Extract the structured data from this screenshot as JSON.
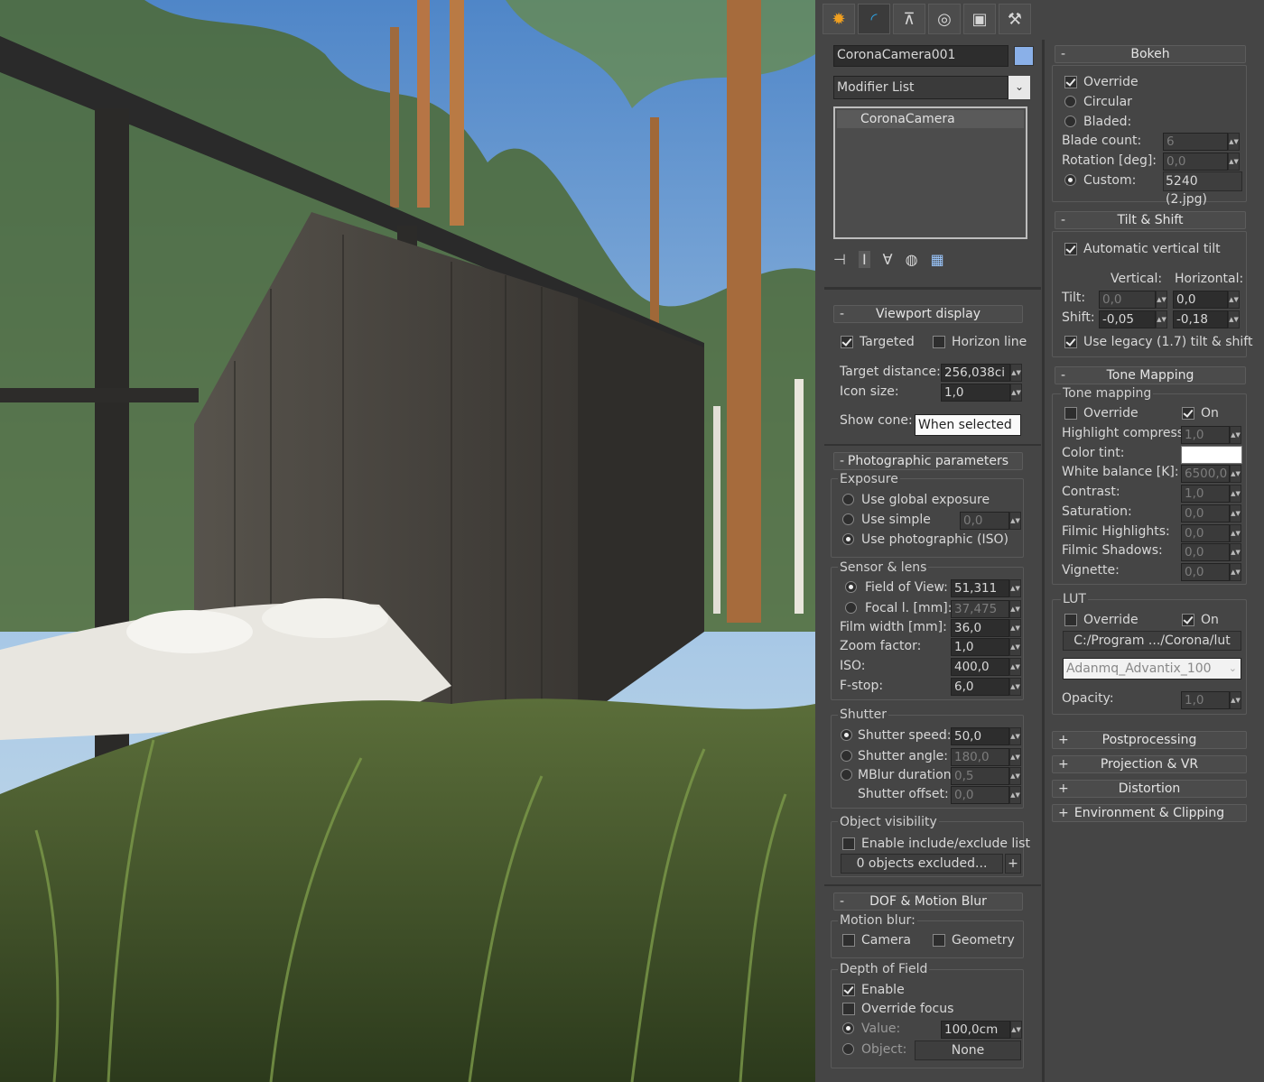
{
  "tabs": [
    {
      "icon": "sun-icon",
      "glyph": "✹",
      "color": "#f0a020"
    },
    {
      "icon": "curve-icon",
      "glyph": "◜",
      "color": "#2ea0e0"
    },
    {
      "icon": "hierarchy-icon",
      "glyph": "⊼",
      "color": "#d0d0d0"
    },
    {
      "icon": "motion-icon",
      "glyph": "◎",
      "color": "#d0d0d0"
    },
    {
      "icon": "display-icon",
      "glyph": "▣",
      "color": "#d0d0d0"
    },
    {
      "icon": "hammer-icon",
      "glyph": "⚒",
      "color": "#d0d0d0"
    }
  ],
  "object": {
    "name": "CoronaCamera001",
    "color": "#8ab0e8",
    "modifier_list": "Modifier List",
    "stack_item": "CoronaCamera"
  },
  "viewport": {
    "title": "Viewport display",
    "targeted": "Targeted",
    "horizon": "Horizon line",
    "target_distance_label": "Target distance:",
    "target_distance": "256,038ci",
    "icon_size_label": "Icon size:",
    "icon_size": "1,0",
    "show_cone_label": "Show cone:",
    "show_cone": "When selected"
  },
  "photo": {
    "title": "Photographic parameters",
    "exposure": "Exposure",
    "use_global": "Use global exposure",
    "use_simple": "Use simple",
    "simple_val": "0,0",
    "use_photo": "Use photographic (ISO)",
    "sensor": "Sensor & lens",
    "fov_label": "Field of View:",
    "fov": "51,311",
    "focal_label": "Focal l. [mm]:",
    "focal": "37,475",
    "film_label": "Film width [mm]:",
    "film": "36,0",
    "zoom_label": "Zoom factor:",
    "zoom": "1,0",
    "iso_label": "ISO:",
    "iso": "400,0",
    "fstop_label": "F-stop:",
    "fstop": "6,0",
    "shutter": "Shutter",
    "speed_label": "Shutter speed:",
    "speed": "50,0",
    "angle_label": "Shutter angle:",
    "angle": "180,0",
    "mblur_label": "MBlur duration:",
    "mblur": "0,5",
    "offset_label": "Shutter offset:",
    "offset": "0,0",
    "objvis": "Object visibility",
    "enable_list": "Enable include/exclude list",
    "excluded": "0 objects excluded...",
    "plus": "+"
  },
  "dof": {
    "title": "DOF & Motion Blur",
    "motion": "Motion blur:",
    "camera": "Camera",
    "geometry": "Geometry",
    "depth": "Depth of Field",
    "enable": "Enable",
    "override_focus": "Override focus",
    "value_label": "Value:",
    "value": "100,0cm",
    "object_label": "Object:",
    "object": "None"
  },
  "bokeh": {
    "title": "Bokeh",
    "override": "Override",
    "circular": "Circular",
    "bladed": "Bladed:",
    "blade_label": "Blade count:",
    "blade": "6",
    "rot_label": "Rotation [deg]:",
    "rot": "0,0",
    "custom_label": "Custom:",
    "custom": "5240 (2.jpg)"
  },
  "tilt": {
    "title": "Tilt & Shift",
    "auto": "Automatic vertical tilt",
    "vertical": "Vertical:",
    "horizontal": "Horizontal:",
    "tilt_label": "Tilt:",
    "tilt_v": "0,0",
    "tilt_h": "0,0",
    "shift_label": "Shift:",
    "shift_v": "-0,05",
    "shift_h": "-0,18",
    "legacy": "Use legacy (1.7) tilt & shift"
  },
  "tone": {
    "title": "Tone Mapping",
    "group": "Tone mapping",
    "override": "Override",
    "on": "On",
    "hc_label": "Highlight compress:",
    "hc": "1,0",
    "tint_label": "Color tint:",
    "tint_color": "#ffffff",
    "wb_label": "White balance [K]:",
    "wb": "6500,0",
    "contrast_label": "Contrast:",
    "contrast": "1,0",
    "sat_label": "Saturation:",
    "sat": "0,0",
    "fh_label": "Filmic Highlights:",
    "fh": "0,0",
    "fs_label": "Filmic Shadows:",
    "fs": "0,0",
    "vig_label": "Vignette:",
    "vig": "0,0",
    "lut": "LUT",
    "lut_override": "Override",
    "lut_on": "On",
    "lut_path": "C:/Program .../Corona/lut",
    "lut_name": "Adanmq_Advantix_100",
    "opacity_label": "Opacity:",
    "opacity": "1,0"
  },
  "collapsed": [
    {
      "label": "Postprocessing"
    },
    {
      "label": "Projection & VR"
    },
    {
      "label": "Distortion"
    },
    {
      "label": "Environment & Clipping"
    }
  ],
  "sign_minus": "-",
  "sign_plus": "+"
}
